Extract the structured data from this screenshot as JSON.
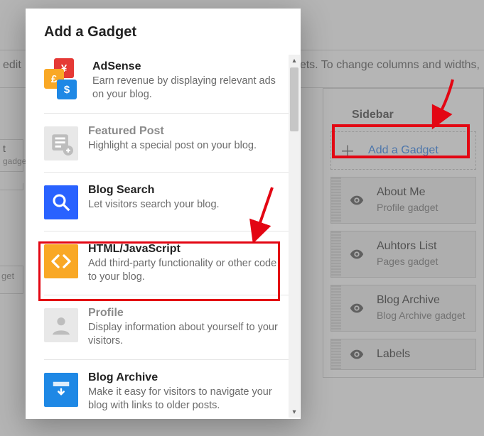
{
  "bg": {
    "top_hint_left": "edit",
    "top_hint_right": "ets. To change columns and widths,",
    "left_frag1_title": "t",
    "left_frag1_sub": "gadget",
    "left_frag3": "get",
    "sidebar": {
      "title": "Sidebar",
      "add_label": "Add a Gadget",
      "widgets": [
        {
          "title": "About Me",
          "sub": "Profile gadget"
        },
        {
          "title": "Auhtors List",
          "sub": "Pages gadget"
        },
        {
          "title": "Blog Archive",
          "sub": "Blog Archive gadget"
        },
        {
          "title": "Labels",
          "sub": ""
        }
      ]
    }
  },
  "modal": {
    "title": "Add a Gadget",
    "gadgets": [
      {
        "id": "adsense",
        "title": "AdSense",
        "desc": "Earn revenue by displaying relevant ads on your blog.",
        "dim": false
      },
      {
        "id": "featured",
        "title": "Featured Post",
        "desc": "Highlight a special post on your blog.",
        "dim": true
      },
      {
        "id": "search",
        "title": "Blog Search",
        "desc": "Let visitors search your blog.",
        "dim": false
      },
      {
        "id": "html",
        "title": "HTML/JavaScript",
        "desc": "Add third-party functionality or other code to your blog.",
        "dim": false
      },
      {
        "id": "profile",
        "title": "Profile",
        "desc": "Display information about yourself to your visitors.",
        "dim": true
      },
      {
        "id": "archive",
        "title": "Blog Archive",
        "desc": "Make it easy for visitors to navigate your blog with links to older posts.",
        "dim": false
      }
    ]
  },
  "annotations": {
    "highlight_color": "#e30613"
  }
}
